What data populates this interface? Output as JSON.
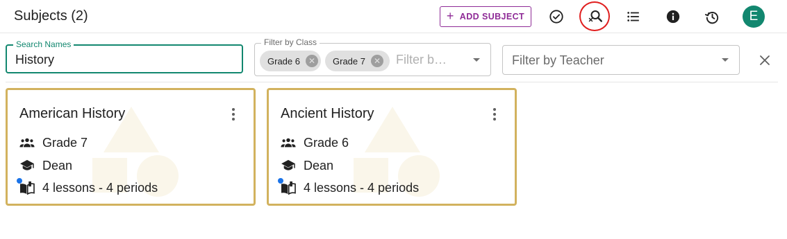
{
  "header": {
    "title": "Subjects (2)",
    "add_button": "ADD SUBJECT",
    "avatar_initial": "E",
    "icons": [
      "check-circle-icon",
      "search-clear-icon",
      "list-icon",
      "info-icon",
      "history-icon"
    ]
  },
  "filters": {
    "search": {
      "label": "Search Names",
      "value": "History"
    },
    "class": {
      "label": "Filter by Class",
      "chips": [
        "Grade 6",
        "Grade 7"
      ],
      "placeholder": "Filter b…"
    },
    "teacher": {
      "placeholder": "Filter by Teacher"
    }
  },
  "cards": [
    {
      "title": "American History",
      "grade": "Grade 7",
      "teacher": "Dean",
      "lessons": "4 lessons - 4 periods"
    },
    {
      "title": "Ancient History",
      "grade": "Grade 6",
      "teacher": "Dean",
      "lessons": "4 lessons - 4 periods"
    }
  ],
  "colors": {
    "accent": "#12876f",
    "add_button": "#8e2a96",
    "card_border": "#d2b25e",
    "highlight_ring": "#e01e1e",
    "notification_dot": "#1a73e8"
  }
}
